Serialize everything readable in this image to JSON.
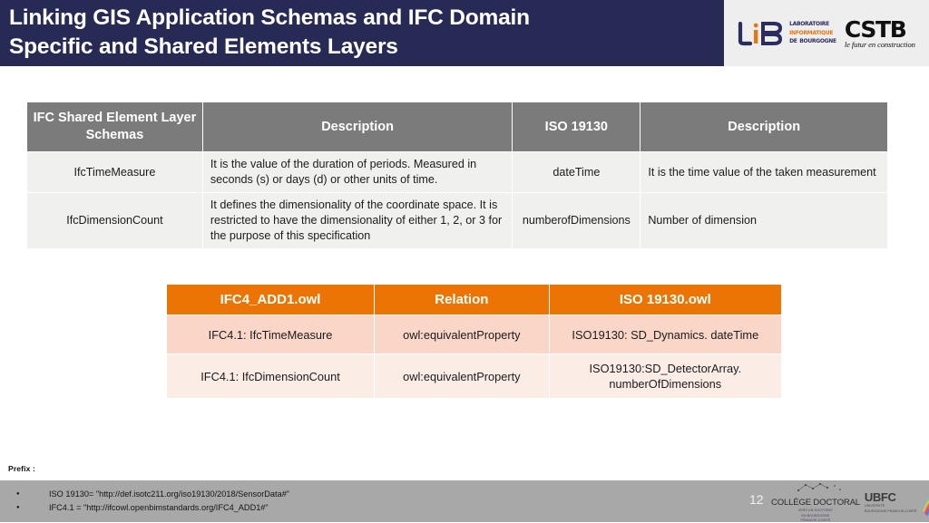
{
  "slide": {
    "title": "Linking GIS Application Schemas and IFC Domain\nSpecific and Shared Elements Layers",
    "page_number": "12",
    "colors": {
      "title_bar": "#262a55",
      "table_header_gray": "#7b7b7b",
      "table_row_gray": "#f0f0ee",
      "table_header_orange": "#ec7404",
      "table_row_pink_dark": "#f9d6c8",
      "table_row_pink_light": "#fcece6",
      "footer_bar": "#a8a8a8"
    }
  },
  "logos": {
    "lib": {
      "mark": "lib-monogram",
      "line1": "Laboratoire",
      "line2": "Informatique",
      "line3": "de Bourgogne"
    },
    "cstb": {
      "name": "CSTB",
      "tagline": "le futur en construction"
    },
    "college_doctoral": {
      "name": "COLLÈGE DOCTORAL",
      "sub1": "VERS UN DOCTORAT",
      "sub2": "EN BOURGOGNE",
      "sub3": "FRANCHE-COMTÉ"
    },
    "ubfc": {
      "name": "UBFC",
      "sub1": "UNIVERSITÉ",
      "sub2": "BOURGOGNE FRANCHE-COMTÉ"
    }
  },
  "ifc_iso_table": {
    "headers": [
      "IFC Shared Element Layer Schemas",
      "Description",
      "ISO 19130",
      "Description"
    ],
    "rows": [
      {
        "ifc_term": "IfcTimeMeasure",
        "ifc_description": "It is the value of the duration of periods. Measured in seconds (s) or days (d) or other units of time.",
        "iso_term": "dateTime",
        "iso_description": "It is the time value of the taken measurement"
      },
      {
        "ifc_term": "IfcDimensionCount",
        "ifc_description": "It defines the dimensionality of the coordinate space. It is restricted to have the dimensionality of either 1, 2, or 3 for the purpose of this specification",
        "iso_term": "numberofDimensions",
        "iso_description": "Number of dimension"
      }
    ]
  },
  "mapping_table": {
    "headers": [
      "IFC4_ADD1.owl",
      "Relation",
      "ISO 19130.owl"
    ],
    "rows": [
      {
        "ifc": "IFC4.1: IfcTimeMeasure",
        "relation": "owl:equivalentProperty",
        "iso": "ISO19130: SD_Dynamics. dateTime"
      },
      {
        "ifc": "IFC4.1: IfcDimensionCount",
        "relation": "owl:equivalentProperty",
        "iso": "ISO19130:SD_DetectorArray. numberOfDimensions"
      }
    ]
  },
  "prefix": {
    "label": "Prefix :",
    "items": [
      "ISO 19130= \"http://def.isotc211.org/iso19130/2018/SensorData#\"",
      "IFC4.1 = \"http://ifcowl.openbimstandards.org/IFC4_ADD1#\""
    ]
  }
}
